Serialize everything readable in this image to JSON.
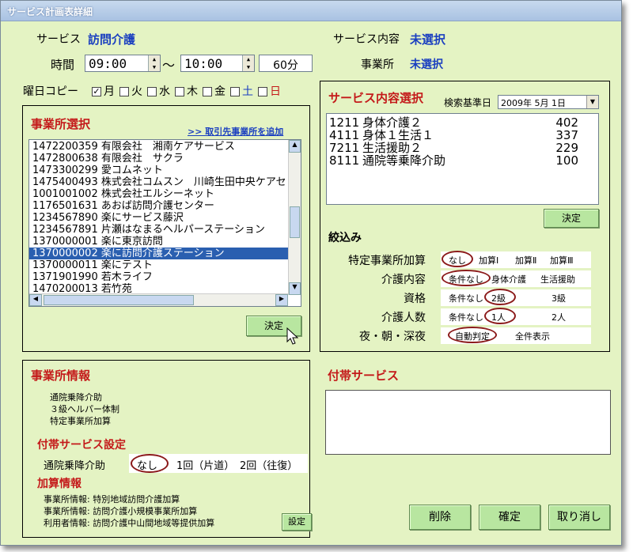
{
  "window": {
    "title": "サービス計画表詳細"
  },
  "header": {
    "service_label": "サービス",
    "service_value": "訪問介護",
    "content_label": "サービス内容",
    "content_value": "未選択",
    "time_label": "時間",
    "start_time": "09:00",
    "tilde": "～",
    "end_time": "10:00",
    "duration": "60分",
    "office_label": "事業所",
    "office_value": "未選択"
  },
  "weekday_copy": {
    "label": "曜日コピー",
    "days": [
      {
        "label": "月",
        "checked": true,
        "color": "#000000"
      },
      {
        "label": "火",
        "checked": false,
        "color": "#000000"
      },
      {
        "label": "水",
        "checked": false,
        "color": "#000000"
      },
      {
        "label": "木",
        "checked": false,
        "color": "#000000"
      },
      {
        "label": "金",
        "checked": false,
        "color": "#000000"
      },
      {
        "label": "土",
        "checked": false,
        "color": "#1a3fc0"
      },
      {
        "label": "日",
        "checked": false,
        "color": "#c41a1a"
      }
    ]
  },
  "office_select": {
    "title": "事業所選択",
    "add_link": ">> 取引先事業所を追加",
    "rows": [
      "1472200359 有限会社　湘南ケアサービス",
      "1472800638 有限会社　サクラ",
      "1473300299 愛コムネット",
      "1475400493 株式会社コムスン　川崎生田中央ケアセ",
      "1001001002 株式会社エルシーネット",
      "1176501631 あおば訪問介護センター",
      "1234567890 楽にサービス藤沢",
      "1234567891 片瀬はなまるヘルパーステーション",
      "1370000001 楽に東京訪問",
      "1370000002 楽に訪問介護ステーション",
      "1370000011 楽にテスト",
      "1371901990 若木ライフ",
      "1470200013 若竹苑"
    ],
    "selected_index": 9,
    "confirm": "決定"
  },
  "content_select": {
    "title": "サービス内容選択",
    "search_date_label": "検索基準日",
    "search_date": "2009年  5月  1日",
    "items": [
      {
        "code": "1211",
        "name": "身体介護２",
        "units": "402"
      },
      {
        "code": "4111",
        "name": "身体１生活１",
        "units": "337"
      },
      {
        "code": "7211",
        "name": "生活援助２",
        "units": "229"
      },
      {
        "code": "8111",
        "name": "通院等乗降介助",
        "units": "100"
      }
    ],
    "confirm": "決定",
    "filter_title": "絞込み",
    "filters": [
      {
        "label": "特定事業所加算",
        "options": [
          "なし",
          "加算Ⅰ",
          "加算Ⅱ",
          "加算Ⅲ"
        ],
        "selected": 0
      },
      {
        "label": "介護内容",
        "options": [
          "条件なし",
          "身体介護",
          "生活援助"
        ],
        "selected": 0
      },
      {
        "label": "資格",
        "options": [
          "条件なし",
          "2級",
          "3級"
        ],
        "selected": 1
      },
      {
        "label": "介護人数",
        "options": [
          "条件なし",
          "1人",
          "2人"
        ],
        "selected": 1
      },
      {
        "label": "夜・朝・深夜",
        "options": [
          "自動判定",
          "全件表示"
        ],
        "selected": 0
      }
    ]
  },
  "office_info": {
    "title": "事業所情報",
    "lines": [
      "通院乗降介助",
      "３級ヘルパー体制",
      "特定事業所加算"
    ],
    "aux_title": "付帯サービス設定",
    "aux_label": "通院乗降介助",
    "aux_options": [
      "なし",
      "1回（片道）",
      "2回（往復）"
    ],
    "aux_selected": 0,
    "add_title": "加算情報",
    "add_lines": [
      "事業所情報: 特別地域訪問介護加算",
      "事業所情報: 訪問介護小規模事業所加算",
      "利用者情報: 訪問介護中山間地域等提供加算"
    ],
    "settings": "設定"
  },
  "aux_service": {
    "title": "付帯サービス"
  },
  "footer": {
    "delete": "削除",
    "confirm": "確定",
    "cancel": "取り消し"
  }
}
